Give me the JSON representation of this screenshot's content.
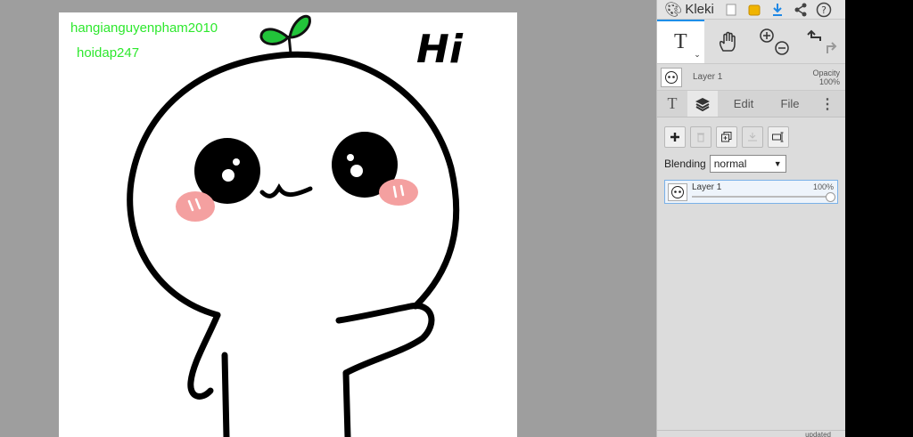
{
  "canvas": {
    "watermark_1": "hangianguyenpham2010",
    "watermark_2": "hoidap247",
    "drawing_text": "Hi",
    "accent_green": "#22c43a",
    "blush_color": "#f4a0a0"
  },
  "topbar": {
    "app_name": "Kleki",
    "icons": [
      "new-document-icon",
      "save-icon",
      "download-icon",
      "share-icon",
      "help-icon"
    ]
  },
  "tools": {
    "text_glyph": "T",
    "icons": [
      "text-tool-icon",
      "hand-tool-icon",
      "zoom-in-icon",
      "zoom-out-icon",
      "undo-icon",
      "redo-icon"
    ]
  },
  "layer_header": {
    "layer_name": "Layer 1",
    "opacity_label": "Opacity",
    "opacity_value": "100%"
  },
  "tabs": {
    "text_tab": "T",
    "edit": "Edit",
    "file": "File"
  },
  "layer_buttons": [
    "add-layer-icon",
    "delete-layer-icon",
    "duplicate-layer-icon",
    "merge-layer-icon",
    "rename-layer-icon"
  ],
  "blending": {
    "label": "Blending",
    "value": "normal"
  },
  "layer_list": [
    {
      "name": "Layer 1",
      "opacity": "100%"
    }
  ],
  "status": {
    "text": "updated"
  }
}
